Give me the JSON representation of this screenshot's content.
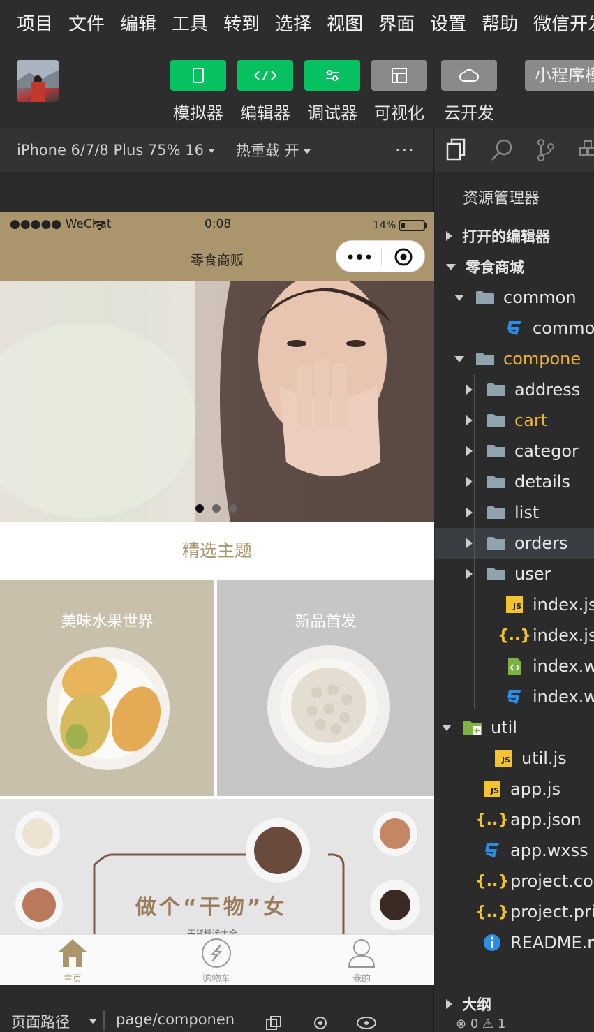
{
  "menu": [
    "项目",
    "文件",
    "编辑",
    "工具",
    "转到",
    "选择",
    "视图",
    "界面",
    "设置",
    "帮助",
    "微信开发"
  ],
  "toolbar": {
    "buttons": [
      {
        "label": "模拟器",
        "icon": "phone-icon"
      },
      {
        "label": "编辑器",
        "icon": "code-icon"
      },
      {
        "label": "调试器",
        "icon": "sliders-icon"
      },
      {
        "label": "可视化",
        "icon": "layout-icon"
      },
      {
        "label": "云开发",
        "icon": "cloud-icon"
      }
    ],
    "mini_program_label": "小程序模"
  },
  "simulator": {
    "device": "iPhone 6/7/8 Plus 75% 16",
    "hot_reload": "热重载 开",
    "more": "···",
    "status": {
      "carrier": "●●●●● WeChat",
      "time": "0:08",
      "battery": "14%"
    },
    "nav_title": "零食商贩",
    "section_title": "精选主题",
    "tiles": [
      "美味水果世界",
      "新品首发"
    ],
    "promo": {
      "headline": "做个“干物”女",
      "sub": "干货精选大全"
    },
    "tabs": [
      {
        "label": "主页",
        "icon": "home-icon",
        "active": true
      },
      {
        "label": "购物车",
        "icon": "cart-icon",
        "active": false
      },
      {
        "label": "我的",
        "icon": "user-icon",
        "active": false
      }
    ],
    "path_label": "页面路径",
    "path_value": "page/componen"
  },
  "explorer": {
    "title": "资源管理器",
    "sections": {
      "open_editors": "打开的编辑器",
      "project": "零食商城",
      "outline": "大纲"
    },
    "tree": [
      {
        "label": "common",
        "type": "folder-open"
      },
      {
        "label": "commo",
        "type": "css"
      },
      {
        "label": "compone",
        "type": "folder-open",
        "highlight": true
      },
      {
        "label": "address",
        "type": "folder"
      },
      {
        "label": "cart",
        "type": "folder",
        "highlight": true
      },
      {
        "label": "categor",
        "type": "folder"
      },
      {
        "label": "details",
        "type": "folder"
      },
      {
        "label": "list",
        "type": "folder"
      },
      {
        "label": "orders",
        "type": "folder",
        "selected": true
      },
      {
        "label": "user",
        "type": "folder"
      },
      {
        "label": "index.js",
        "type": "js"
      },
      {
        "label": "index.js",
        "type": "json"
      },
      {
        "label": "index.w",
        "type": "wxml"
      },
      {
        "label": "index.w",
        "type": "css"
      },
      {
        "label": "util",
        "type": "folder-special"
      },
      {
        "label": "util.js",
        "type": "js"
      },
      {
        "label": "app.js",
        "type": "js"
      },
      {
        "label": "app.json",
        "type": "json"
      },
      {
        "label": "app.wxss",
        "type": "css"
      },
      {
        "label": "project.co",
        "type": "json"
      },
      {
        "label": "project.pri",
        "type": "json"
      },
      {
        "label": "README.r",
        "type": "info"
      }
    ],
    "problems": {
      "errors": "0",
      "warnings": "1"
    }
  },
  "colors": {
    "accent": "#07c160",
    "brand": "#ab956d",
    "highlight": "#e8b23c"
  }
}
